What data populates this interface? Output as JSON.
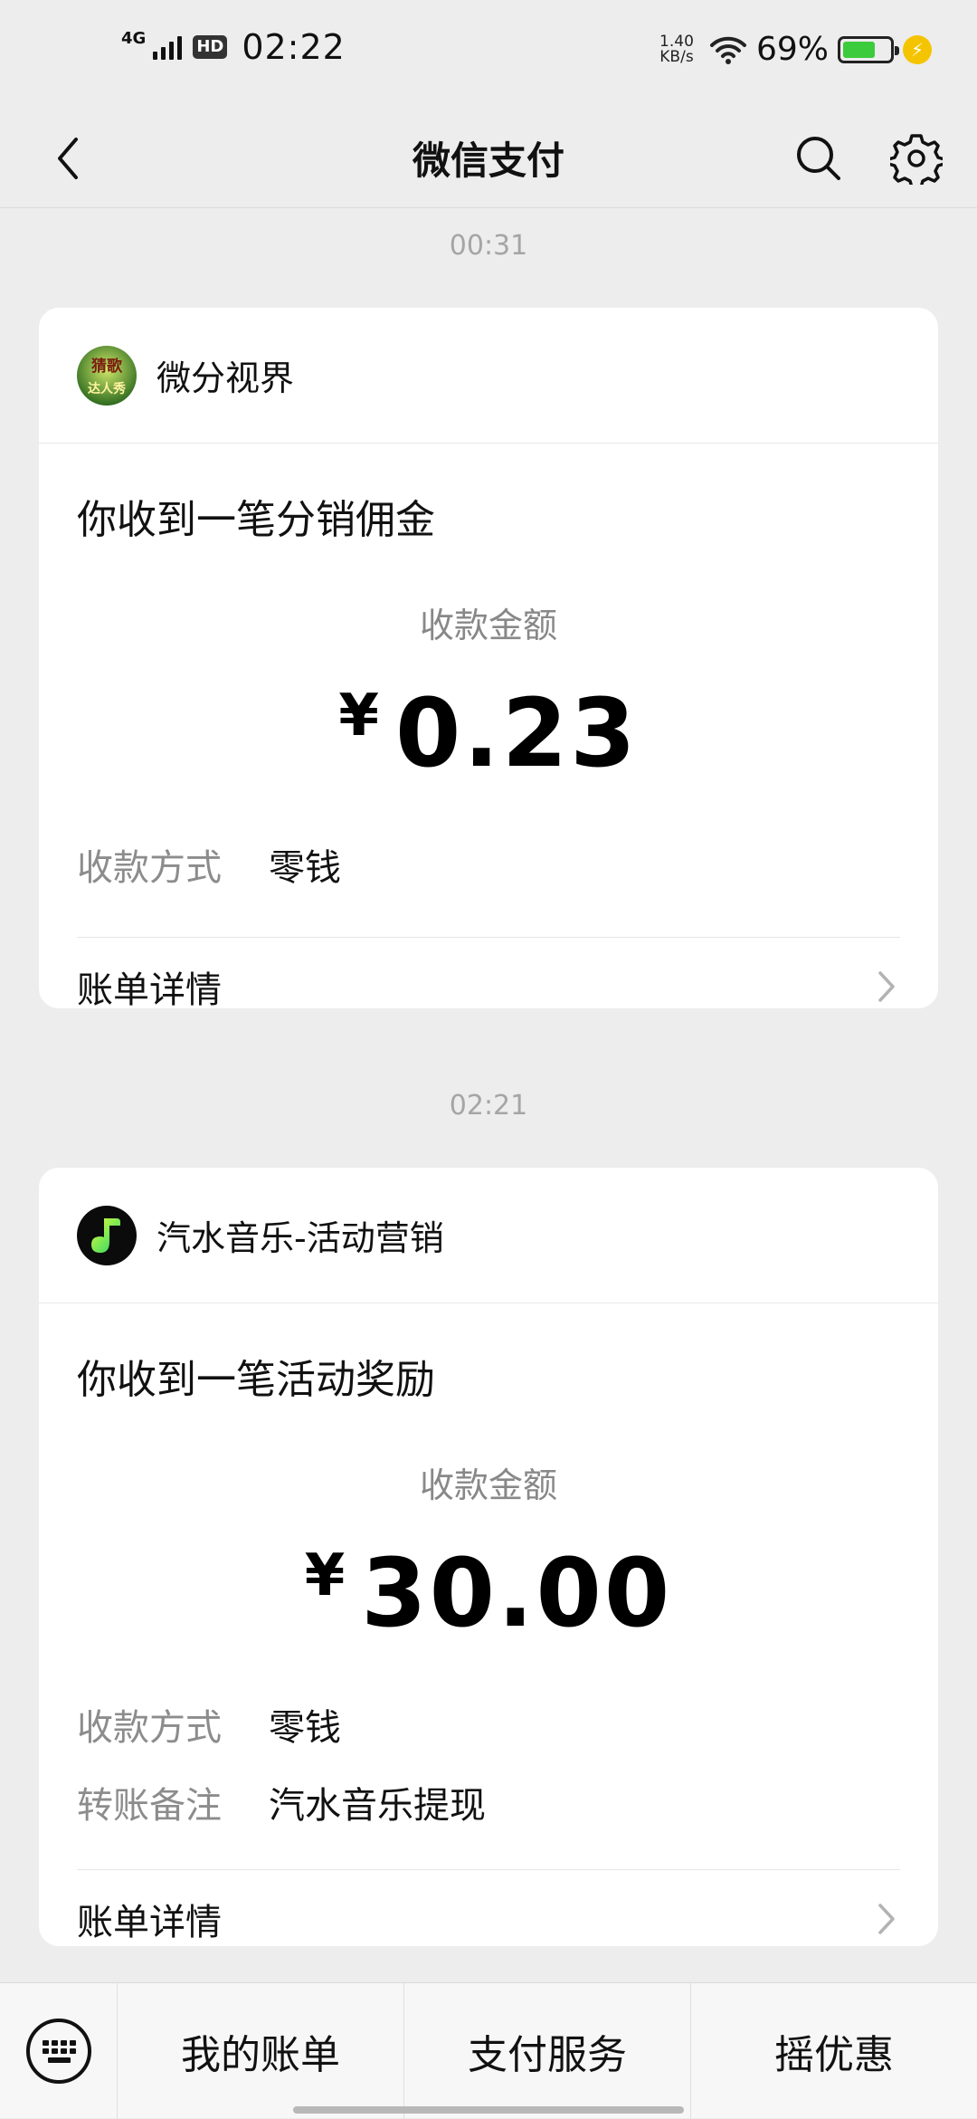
{
  "status_bar": {
    "network": "4G",
    "hd": "HD",
    "time": "02:22",
    "net_speed_value": "1.40",
    "net_speed_unit": "KB/s",
    "battery_percent": "69%",
    "battery_level": 0.69,
    "charging": true
  },
  "header": {
    "title": "微信支付",
    "back_icon": "chevron-left-icon",
    "search_icon": "search-icon",
    "settings_icon": "gear-icon"
  },
  "messages": [
    {
      "timestamp": "00:31",
      "sender": "微分视界",
      "avatar_text_top": "猜歌",
      "avatar_text_bottom": "达人秀",
      "headline": "你收到一笔分销佣金",
      "amount_label": "收款金额",
      "currency": "¥",
      "amount": "0.23",
      "details": [
        {
          "label": "收款方式",
          "value": "零钱"
        }
      ],
      "bill_link": "账单详情"
    },
    {
      "timestamp": "02:21",
      "sender": "汽水音乐-活动营销",
      "headline": "你收到一笔活动奖励",
      "amount_label": "收款金额",
      "currency": "¥",
      "amount": "30.00",
      "details": [
        {
          "label": "收款方式",
          "value": "零钱"
        },
        {
          "label": "转账备注",
          "value": "汽水音乐提现"
        }
      ],
      "bill_link": "账单详情"
    }
  ],
  "bottom_menu": {
    "keyboard_icon": "keyboard-icon",
    "items": [
      "我的账单",
      "支付服务",
      "摇优惠"
    ]
  },
  "colors": {
    "background": "#ededed",
    "card": "#ffffff",
    "muted_text": "#8c8c8c",
    "battery_green": "#3ccb3c"
  }
}
